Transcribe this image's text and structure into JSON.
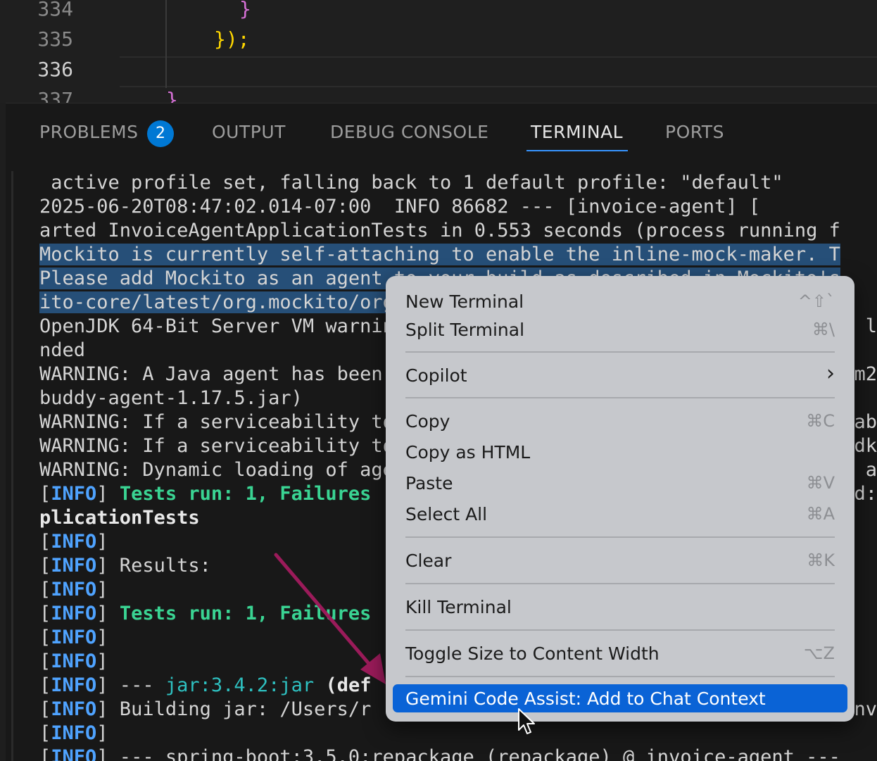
{
  "editor": {
    "line_numbers": [
      "334",
      "335",
      "336",
      "337"
    ],
    "lines": [
      {
        "text": "}",
        "color": "#d670d6"
      },
      {
        "text": "});",
        "color": "#ffd700"
      },
      {
        "text": "",
        "color": "#d4d4d4"
      },
      {
        "text": "}",
        "color": "#d670d6"
      }
    ]
  },
  "panel": {
    "tabs": [
      {
        "label": "PROBLEMS",
        "active": false
      },
      {
        "label": "OUTPUT",
        "active": false
      },
      {
        "label": "DEBUG CONSOLE",
        "active": false
      },
      {
        "label": "TERMINAL",
        "active": true
      },
      {
        "label": "PORTS",
        "active": false
      }
    ],
    "problems_count": "2"
  },
  "terminal": {
    "lines": [
      " active profile set, falling back to 1 default profile: \"default\"",
      "2025-06-20T08:47:02.014-07:00  INFO 86682 --- [invoice-agent] [",
      "arted InvoiceAgentApplicationTests in 0.553 seconds (process running f",
      "Mockito is currently self-attaching to enable the inline-mock-maker. T",
      "Please add Mockito as an agent to your build as described in Mockito's",
      "ito-core/latest/org.mockito/org",
      "OpenJDK 64-Bit Server VM warning",
      "nded",
      "WARNING: A Java agent has been loaded dynamically",
      "buddy-agent-1.17.5.jar)",
      "WARNING: If a serviceability tool is in use, please run with -XX:+Enab",
      "WARNING: If a serviceability tool is not in use, please run with -Djdk",
      "WARNING: Dynamic loading of agents will be disallowed by default in a",
      "[INFO] Tests run: 1, Failures",
      "plicationTests",
      "[INFO]",
      "[INFO] Results:",
      "[INFO]",
      "[INFO] Tests run: 1, Failures",
      "[INFO]",
      "[INFO]",
      "[INFO] --- jar:3.4.2:jar (def",
      "[INFO] Building jar: /Users/r",
      "[INFO]",
      "[INFO] --- spring-boot:3.5.0:repackage (repackage) @ invoice-agent ---"
    ],
    "right_fragments": [
      {
        "line": 6,
        "text": "l"
      },
      {
        "line": 8,
        "text": "m2"
      },
      {
        "line": 10,
        "text": "ab"
      },
      {
        "line": 11,
        "text": "dk"
      },
      {
        "line": 12,
        "text": "a"
      },
      {
        "line": 13,
        "text": "d:"
      },
      {
        "line": 22,
        "text": "nv"
      }
    ]
  },
  "context_menu": {
    "items": [
      {
        "label": "New Terminal",
        "shortcut": "^⇧`"
      },
      {
        "label": "Split Terminal",
        "shortcut": "⌘\\"
      },
      {
        "separator": true
      },
      {
        "label": "Copilot",
        "submenu": "›"
      },
      {
        "separator": true
      },
      {
        "label": "Copy",
        "shortcut": "⌘C"
      },
      {
        "label": "Copy as HTML",
        "shortcut": ""
      },
      {
        "label": "Paste",
        "shortcut": "⌘V"
      },
      {
        "label": "Select All",
        "shortcut": "⌘A"
      },
      {
        "separator": true
      },
      {
        "label": "Clear",
        "shortcut": "⌘K"
      },
      {
        "separator": true
      },
      {
        "label": "Kill Terminal",
        "shortcut": ""
      },
      {
        "separator": true
      },
      {
        "label": "Toggle Size to Content Width",
        "shortcut": "⌥Z"
      },
      {
        "separator": true
      },
      {
        "label": "Gemini Code Assist: Add to Chat Context",
        "shortcut": "",
        "highlighted": true
      }
    ]
  },
  "colors": {
    "accent": "#3794ff",
    "menu_highlight": "#0a63d6",
    "selection": "#264f78",
    "annotation_arrow": "#9b1b5a"
  }
}
